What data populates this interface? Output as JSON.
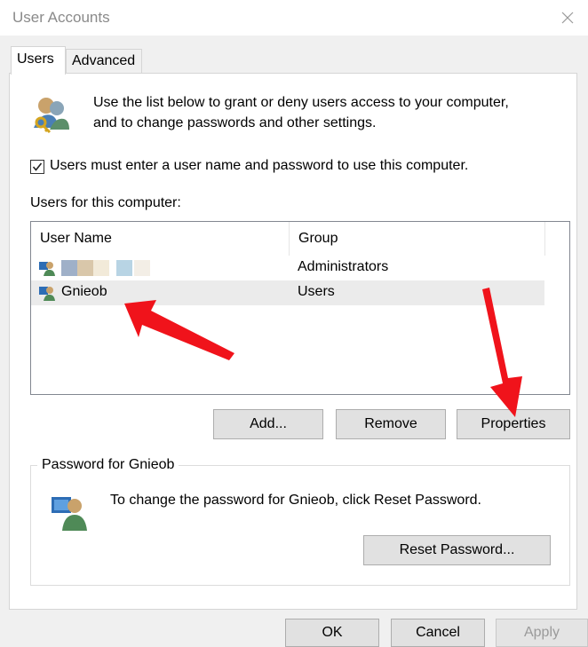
{
  "window": {
    "title": "User Accounts"
  },
  "tabs": [
    {
      "label": "Users",
      "active": true
    },
    {
      "label": "Advanced",
      "active": false
    }
  ],
  "intro": {
    "line1": "Use the list below to grant or deny users access to your computer,",
    "line2": "and to change passwords and other settings."
  },
  "checkbox": {
    "label": "Users must enter a user name and password to use this computer.",
    "checked": true
  },
  "users_section": {
    "label": "Users for this computer:",
    "columns": [
      "User Name",
      "Group"
    ],
    "rows": [
      {
        "name": "",
        "group": "Administrators",
        "name_obscured": true
      },
      {
        "name": "Gnieob",
        "group": "Users",
        "selected": true
      }
    ]
  },
  "buttons": {
    "add": "Add...",
    "remove": "Remove",
    "properties": "Properties"
  },
  "password_group": {
    "legend": "Password for Gnieob",
    "text": "To change the password for Gnieob, click Reset Password.",
    "reset_button": "Reset Password..."
  },
  "footer": {
    "ok": "OK",
    "cancel": "Cancel",
    "apply": "Apply",
    "apply_enabled": false
  },
  "colors": {
    "annotation_arrow": "#f0131b",
    "selected_row": "#ebebeb",
    "button_face": "#e1e1e1"
  }
}
